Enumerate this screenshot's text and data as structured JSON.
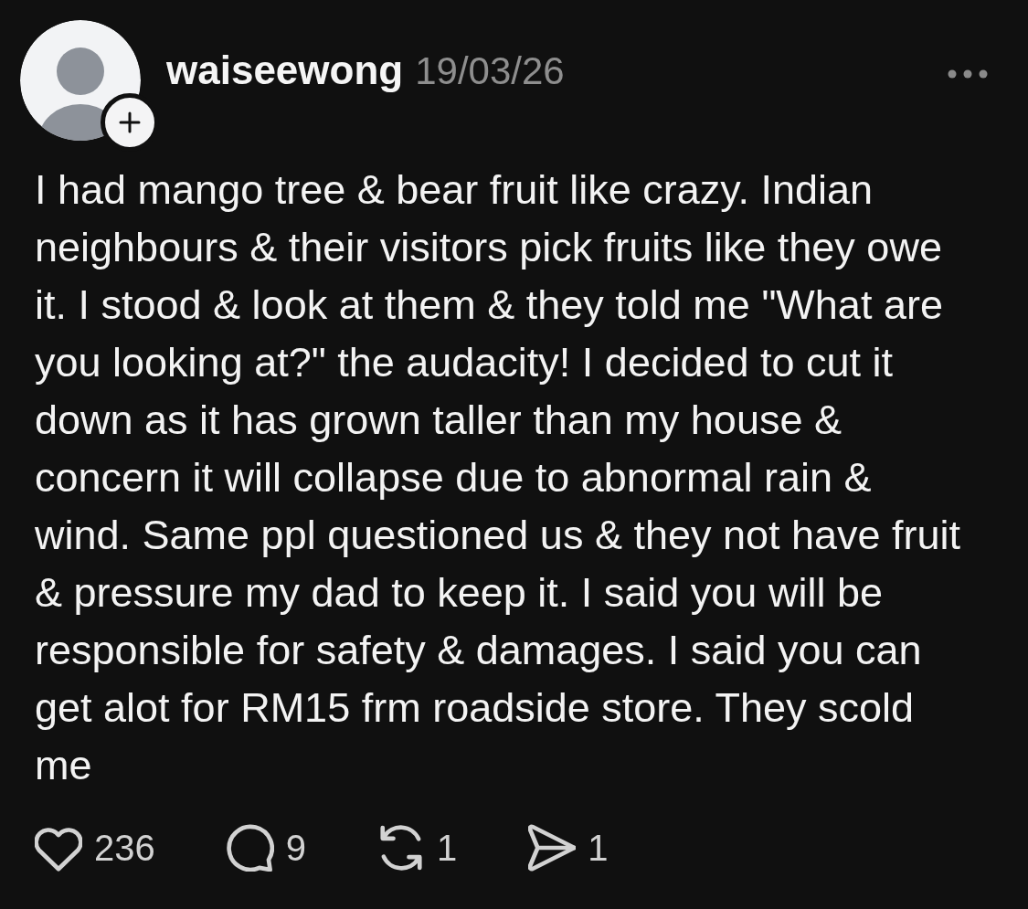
{
  "post": {
    "author": {
      "username": "waiseewong"
    },
    "date": "19/03/26",
    "body": "I had mango tree & bear fruit like crazy. Indian neighbours & their visitors pick fruits like they owe it. I stood & look at them & they told me \"What are you looking at?\" the audacity! I decided to cut it down as it has grown taller than my house & concern it will collapse due to abnormal rain & wind. Same ppl questioned us & they not have fruit & pressure my dad to keep it. I said you will be responsible for safety & damages. I said you can get alot for RM15 frm roadside store. They scold me",
    "actions": [
      {
        "kind": "like",
        "count": "236"
      },
      {
        "kind": "comment",
        "count": "9"
      },
      {
        "kind": "repost",
        "count": "1"
      },
      {
        "kind": "share",
        "count": "1"
      }
    ]
  }
}
